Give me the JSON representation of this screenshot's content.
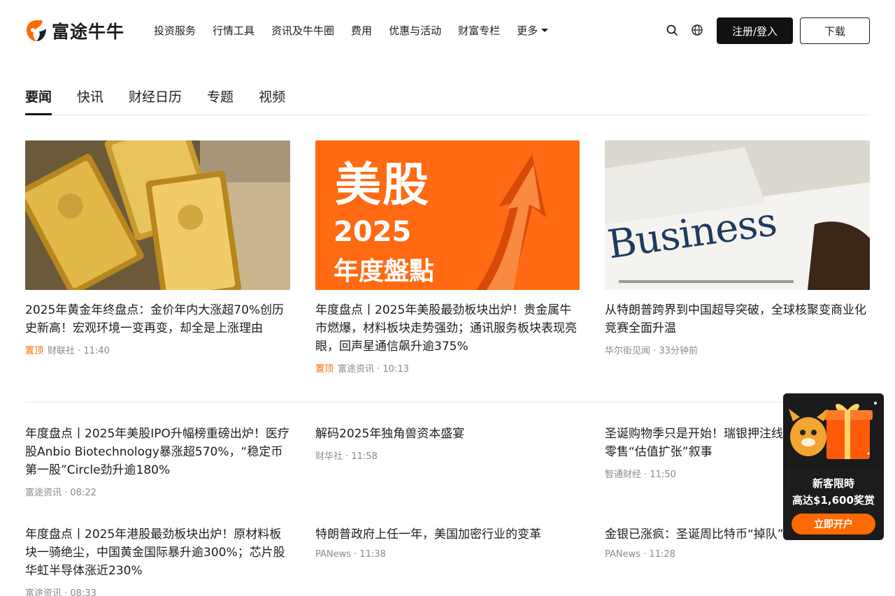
{
  "brand": {
    "name": "富途牛牛",
    "accent": "#ff6a00"
  },
  "nav": [
    {
      "label": "投资服务"
    },
    {
      "label": "行情工具"
    },
    {
      "label": "资讯及牛牛圈"
    },
    {
      "label": "费用"
    },
    {
      "label": "优惠与活动"
    },
    {
      "label": "财富专栏"
    },
    {
      "label": "更多"
    }
  ],
  "header": {
    "login_label": "注册/登入",
    "download_label": "下载"
  },
  "tabs": [
    {
      "label": "要闻"
    },
    {
      "label": "快讯"
    },
    {
      "label": "财经日历"
    },
    {
      "label": "专题"
    },
    {
      "label": "视频"
    }
  ],
  "featured": [
    {
      "title": "2025年黄金年终盘点：金价年内大涨超70%创历史新高！宏观环境一变再变，却全是上涨理由",
      "pin": "置顶",
      "meta": "财联社 · 11:40",
      "image": "gold-bars"
    },
    {
      "title": "年度盘点丨2025年美股最劲板块出炉！贵金属牛市燃爆，材料板块走势强劲；通讯服务板块表现亮眼，回声星通信飙升逾375%",
      "pin": "置顶",
      "meta": "富途资讯 · 10:13",
      "image": "us-stocks-review",
      "image_text_big": "美股",
      "image_text_year": "2025",
      "image_text_sub": "年度盤點"
    },
    {
      "title": "从特朗普跨界到中国超导突破，全球核聚变商业化竞赛全面升温",
      "pin": "",
      "meta": "华尔街见闻 · 33分钟前",
      "image": "business-newspaper",
      "image_text": "Business"
    }
  ],
  "news": [
    {
      "title": "年度盘点丨2025年美股IPO升幅榜重磅出炉！医疗股Anbio Biotechnology暴涨超570%，“稳定币第一股”Circle劲升逾180%",
      "meta": "富途资讯 · 08:22"
    },
    {
      "title": "解码2025年独角兽资本盛宴",
      "meta": "财华社 · 11:58"
    },
    {
      "title": "圣诞购物季只是开始！瑞银押注线零售“估值扩张”叙事",
      "meta": "智通财经 · 11:50"
    },
    {
      "title": "年度盘点丨2025年港股最劲板块出炉！原材料板块一骑绝尘，中国黄金国际暴升逾300%；芯片股华虹半导体涨近230%",
      "meta": "富途资讯 · 08:33"
    },
    {
      "title": "特朗普政府上任一年，美国加密行业的变革",
      "meta": "PANews · 11:38"
    },
    {
      "title": "金银已涨疯：圣诞周比特币“掉队”",
      "meta": "PANews · 11:28"
    }
  ],
  "promo": {
    "line1": "新客限時",
    "line2": "高达$1,600奖赏",
    "button": "立即开户"
  }
}
